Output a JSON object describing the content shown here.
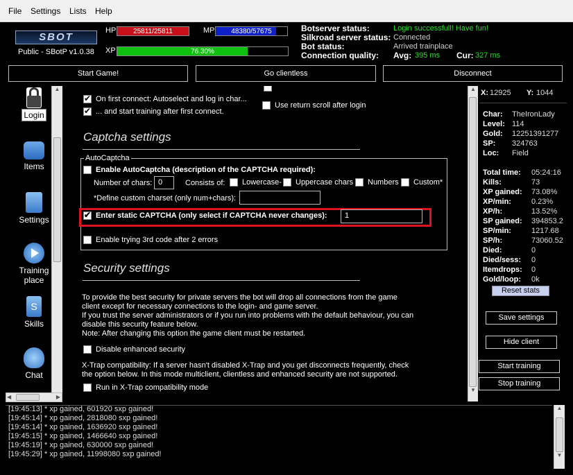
{
  "menu": [
    "File",
    "Settings",
    "Lists",
    "Help"
  ],
  "header": {
    "logo": "SBOT",
    "version": "Public - SBotP v1.0.38",
    "hp_label": "HP",
    "hp_value": "25811/25811",
    "hp_fraction": 1.0,
    "mp_label": "MP",
    "mp_value": "48380/57675",
    "mp_fraction": 0.84,
    "xp_label": "XP",
    "xp_value": "76.30%",
    "xp_fraction": 0.763,
    "status": {
      "botserver_label": "Botserver status:",
      "botserver_value": "Login successfull! Have fun!",
      "silkroad_label": "Silkroad server status:",
      "silkroad_value": "Connected",
      "bot_label": "Bot status:",
      "bot_value": "Arrived trainplace",
      "conn_label": "Connection quality:",
      "avg_label": "Avg:",
      "avg_value": "395 ms",
      "cur_label": "Cur:",
      "cur_value": "327 ms"
    },
    "buttons": {
      "start_game": "Start Game!",
      "clientless": "Go clientless",
      "disconnect": "Disconnect"
    }
  },
  "sidebar": [
    {
      "label": "Login",
      "icon": "lock-icon"
    },
    {
      "label": "Items",
      "icon": "bag-icon"
    },
    {
      "label": "Settings",
      "icon": "clipboard-icon"
    },
    {
      "label": "Training place",
      "icon": "play-icon"
    },
    {
      "label": "Skills",
      "icon": "scroll-icon"
    },
    {
      "label": "Chat",
      "icon": "users-icon"
    }
  ],
  "main": {
    "first_connect": "On first connect: Autoselect and log in char...",
    "start_training": "... and start training after first connect.",
    "return_scroll": "Use return scroll after login",
    "captcha_title": "Captcha settings",
    "autocaptcha_group": "AutoCaptcha",
    "enable_autocaptcha": "Enable AutoCaptcha (description of the CAPTCHA required):",
    "num_chars_label": "Number of chars:",
    "num_chars_value": "0",
    "consists_of": "Consists of:",
    "lowercase": "Lowercase-",
    "uppercase": "Uppercase chars",
    "numbers": "Numbers",
    "custom": "Custom*",
    "custom_charset": "*Define custom charset (only num+chars):",
    "custom_charset_value": "",
    "static_captcha": "Enter static CAPTCHA (only select if CAPTCHA never changes):",
    "static_captcha_value": "1",
    "third_code": "Enable trying 3rd code after 2 errors",
    "security_title": "Security settings",
    "security_p1": "To provide the best security for private servers the bot will drop all connections from the game client except for necessary connections to the login- and game server.",
    "security_p2": "If you trust the server administrators or if you run into problems with the default behaviour, you can disable this security feature below.",
    "security_p3": "Note: After changing this option the game client must be restarted.",
    "disable_security": "Disable enhanced security",
    "xtrap_text": "X-Trap compatibility: If a server hasn't disabled X-Trap and you get disconnects frequently, check the option below. In this mode multiclient, clientless and enhanced security are not supported.",
    "xtrap_mode": "Run in X-Trap compatibility mode"
  },
  "right": {
    "x_label": "X:",
    "x_value": "12925",
    "y_label": "Y:",
    "y_value": "1044",
    "char_label": "Char:",
    "char_value": "TheIronLady",
    "level_label": "Level:",
    "level_value": "114",
    "gold_label": "Gold:",
    "gold_value": "12251391277",
    "sp_label": "SP:",
    "sp_value": "324763",
    "loc_label": "Loc:",
    "loc_value": "Field",
    "total_time_label": "Total time:",
    "total_time_value": "05:24:16",
    "kills_label": "Kills:",
    "kills_value": "73",
    "xp_gained_label": "XP gained:",
    "xp_gained_value": "73.08%",
    "xp_min_label": "XP/min:",
    "xp_min_value": "0.23%",
    "xp_h_label": "XP/h:",
    "xp_h_value": "13.52%",
    "sp_gained_label": "SP gained:",
    "sp_gained_value": "394853.2",
    "sp_min_label": "SP/min:",
    "sp_min_value": "1217.68",
    "sp_h_label": "SP/h:",
    "sp_h_value": "73060.52",
    "died_label": "Died:",
    "died_value": "0",
    "died_sess_label": "Died/sess:",
    "died_sess_value": "0",
    "itemdrops_label": "Itemdrops:",
    "itemdrops_value": "0",
    "gold_loop_label": "Gold/loop:",
    "gold_loop_value": "0k",
    "reset_stats": "Reset stats",
    "save_settings": "Save settings",
    "hide_client": "Hide client",
    "start_training": "Start training",
    "stop_training": "Stop training"
  },
  "log": [
    "[19:45:13] * xp gained, 601920 sxp gained!",
    "[19:45:14] * xp gained, 2818080 sxp gained!",
    "[19:45:14] * xp gained, 1636920 sxp gained!",
    "[19:45:15] * xp gained, 1466640 sxp gained!",
    "[19:45:19] * xp gained, 630000 sxp gained!",
    "[19:45:29] * xp gained, 11998080 sxp gained!"
  ],
  "colors": {
    "accent_green": "#22e022",
    "highlight_red": "#e0141e",
    "hp_red": "#c8101a",
    "mp_blue": "#1020c8"
  }
}
